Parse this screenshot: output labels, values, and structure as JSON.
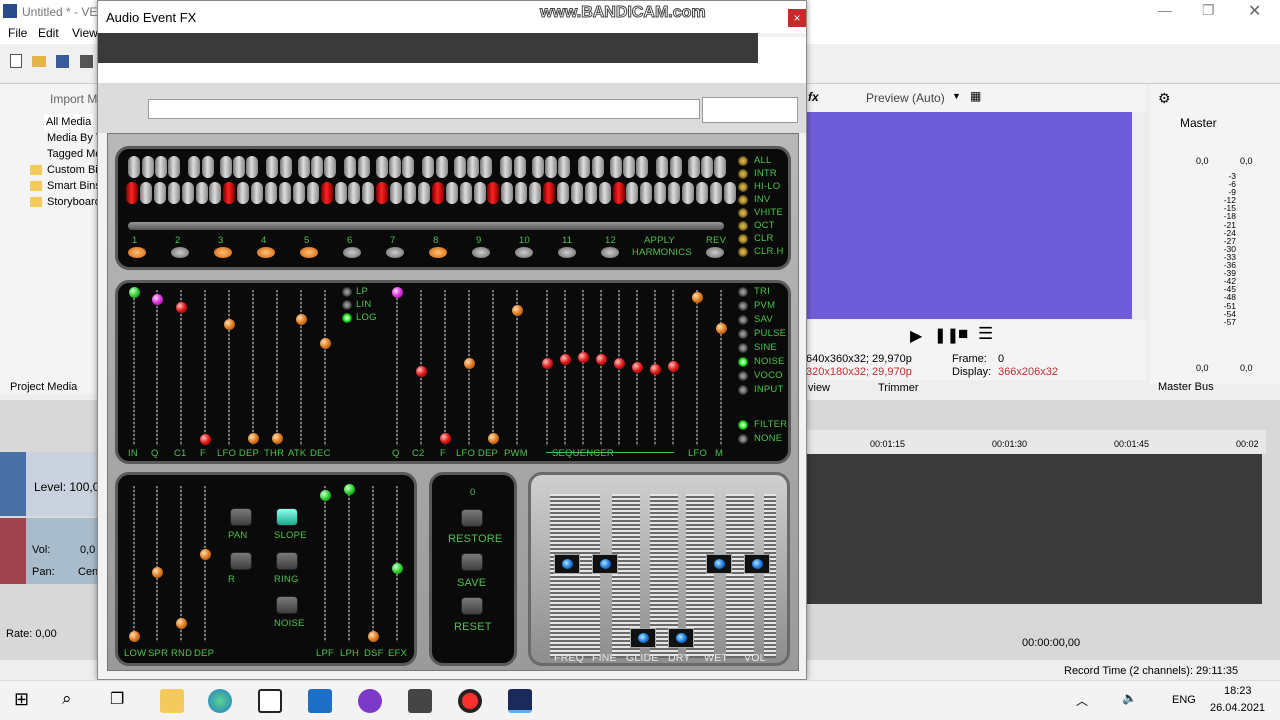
{
  "app": {
    "title": "Untitled * - VEG",
    "menu": [
      "File",
      "Edit",
      "View"
    ],
    "left_panel": {
      "import": "Import M",
      "items": [
        "All Media",
        "Media By T",
        "Tagged Me",
        "Custom Bin",
        "Smart Bins",
        "Storyboard"
      ],
      "tab": "Project Media"
    },
    "preview": {
      "label": "Preview (Auto)",
      "info1": "640x360x32; 29,970p",
      "info2": "320x180x32; 29,970p",
      "frame_label": "Frame:",
      "frame_value": "0",
      "display_label": "Display:",
      "display_value": "366x206x32",
      "tab1": "view",
      "tab2": "Trimmer"
    },
    "master": {
      "label": "Master",
      "left_top": "0,0",
      "right_top": "0,0",
      "scale": [
        "3",
        "6",
        "9",
        "12",
        "15",
        "18",
        "21",
        "24",
        "27",
        "30",
        "33",
        "36",
        "39",
        "42",
        "45",
        "48",
        "51",
        "54",
        "57"
      ],
      "left_bottom": "0,0",
      "right_bottom": "0,0",
      "tab": "Master Bus"
    },
    "timeline": {
      "ruler": [
        "00:01:15",
        "00:01:30",
        "00:01:45",
        "00:02"
      ],
      "track1_level": "Level: 100,0",
      "track2_vol_label": "Vol:",
      "track2_vol": "0,0",
      "track2_pan_label": "Pan:",
      "track2_pan": "Cen",
      "rate": "Rate: 0,00",
      "timecode": "00:00:00,00",
      "record_time": "Record Time (2 channels): 29:11:35"
    }
  },
  "watermark": "www.BANDICAM.com",
  "fx": {
    "title": "Audio Event FX",
    "close": "×",
    "harmonics": {
      "numbers": [
        "1",
        "2",
        "3",
        "4",
        "5",
        "6",
        "7",
        "8",
        "9",
        "10",
        "11",
        "12"
      ],
      "apply": "APPLY",
      "rev": "REV",
      "harmonics_label": "HARMONICS",
      "right": [
        "ALL",
        "INTR",
        "HI-LO",
        "INV",
        "VHITE",
        "OCT",
        "CLR",
        "CLR.H"
      ]
    },
    "synth": {
      "filters": [
        "LP",
        "LIN",
        "LOG"
      ],
      "bottom_labels": [
        "IN",
        "Q",
        "C1",
        "F",
        "LFO DEP",
        "THR",
        "ATK",
        "DEC",
        "Q",
        "C2",
        "F",
        "LFO DEP",
        "PWM",
        "SEQUENCER",
        "LFO",
        "M"
      ],
      "waves": [
        "TRI",
        "PVM",
        "SAV",
        "PULSE",
        "SINE",
        "NOISE",
        "VOCO",
        "INPUT"
      ],
      "filter": "FILTER",
      "none": "NONE"
    },
    "mod": {
      "labels": [
        "LOW",
        "SPR",
        "RND",
        "DEP",
        "LPF",
        "LPH",
        "DSF",
        "EFX"
      ],
      "buttons": [
        "PAN",
        "SLOPE",
        "R",
        "RING",
        "NOISE"
      ]
    },
    "control": {
      "value": "0",
      "restore": "RESTORE",
      "save": "SAVE",
      "reset": "RESET"
    },
    "mixer": {
      "labels": [
        "FREQ",
        "FINE",
        "GLIDE",
        "DRY",
        "WET",
        "VOL"
      ]
    }
  },
  "taskbar": {
    "lang": "ENG",
    "time": "18:23",
    "date": "26.04.2021"
  }
}
